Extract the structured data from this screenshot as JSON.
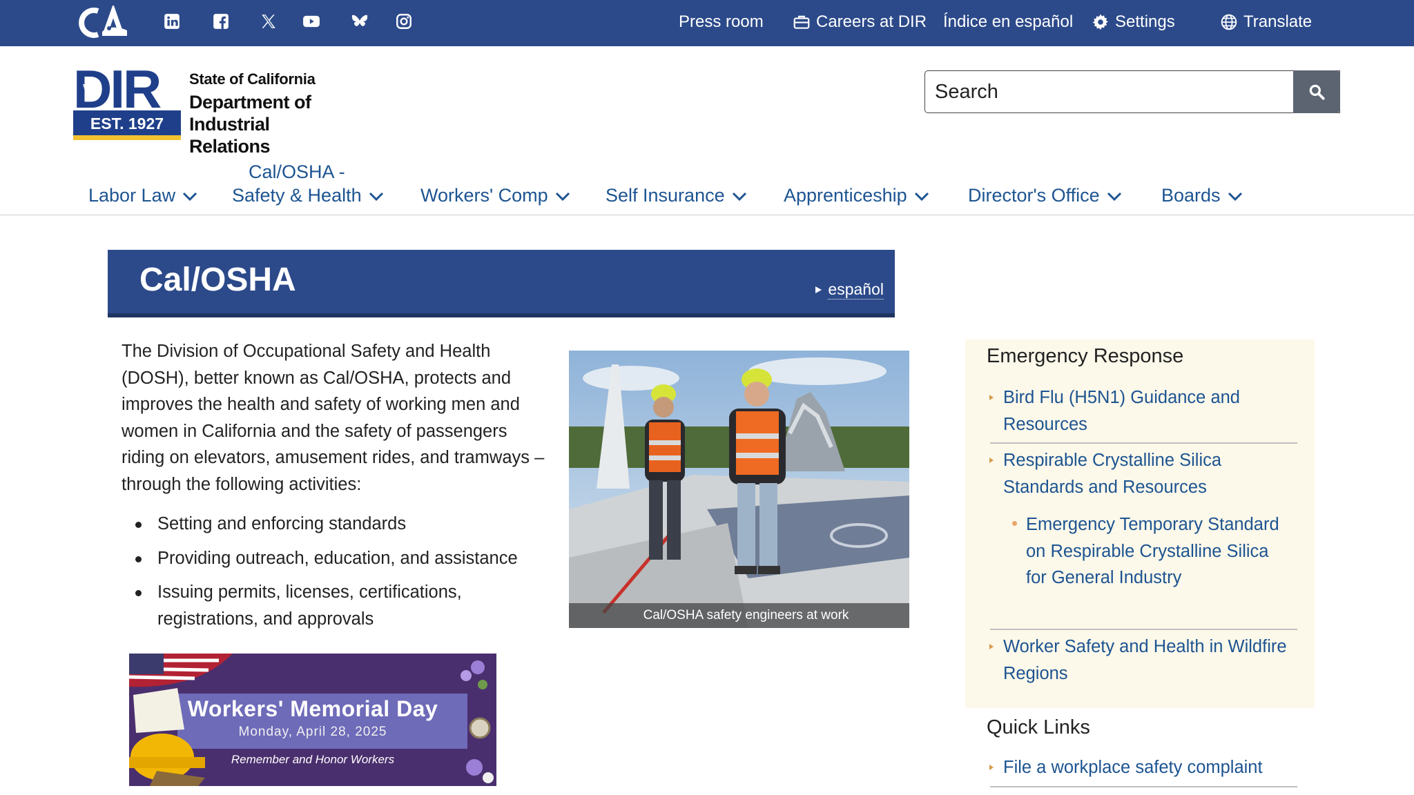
{
  "topbar": {
    "social_icons": [
      "linkedin-icon",
      "facebook-icon",
      "x-icon",
      "youtube-icon",
      "bluesky-icon",
      "instagram-icon"
    ],
    "links": {
      "press_room": "Press room",
      "careers": "Careers at DIR",
      "spanish_index": "Índice en español",
      "settings": "Settings",
      "translate": "Translate"
    }
  },
  "brand": {
    "logo_text": "DIR",
    "est": "EST. 1927",
    "state": "State of California",
    "dept_line1": "Department of",
    "dept_line2": "Industrial Relations"
  },
  "search": {
    "placeholder": "Search"
  },
  "nav": {
    "labor_law": "Labor Law",
    "calosha_line1": "Cal/OSHA -",
    "calosha_line2": "Safety & Health",
    "workers_comp": "Workers' Comp",
    "self_insurance": "Self Insurance",
    "apprenticeship": "Apprenticeship",
    "directors_office": "Director's Office",
    "boards": "Boards"
  },
  "page": {
    "title": "Cal/OSHA",
    "language_link": "español",
    "intro": "The Division of Occupational Safety and Health (DOSH), better known as Cal/OSHA, protects and improves the health and safety of working men and women in California and the safety of passengers riding on elevators, amusement rides, and tramways – through the following activities:",
    "activities": [
      "Setting and enforcing standards",
      "Providing outreach, education, and assistance",
      "Issuing permits, licenses, certifications, registrations, and approvals"
    ],
    "photo_caption": "Cal/OSHA safety engineers at work"
  },
  "memorial": {
    "title": "Workers' Memorial Day",
    "date": "Monday, April 28, 2025",
    "subtitle": "Remember and Honor Workers"
  },
  "sidebar": {
    "emergency_heading": "Emergency Response",
    "emergency_links": [
      "Bird Flu (H5N1) Guidance and Resources",
      "Respirable Crystalline Silica Standards and Resources",
      "Emergency Temporary Standard on Respirable Crystalline Silica for General Industry",
      "Worker Safety and Health in Wildfire Regions"
    ],
    "quick_heading": "Quick Links",
    "quick_links": [
      "File a workplace safety complaint"
    ]
  },
  "colors": {
    "primary_blue": "#2c4a8a",
    "link_blue": "#1d5491",
    "sidebar_bg": "#fcf8ea"
  }
}
